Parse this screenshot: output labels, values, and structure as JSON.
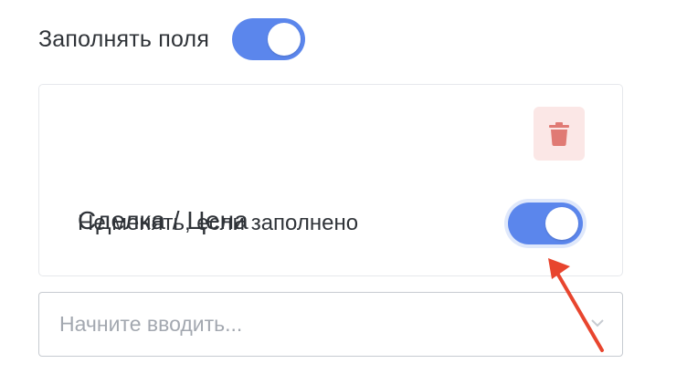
{
  "fill_fields": {
    "label": "Заполнять поля",
    "enabled": true
  },
  "field_card": {
    "title": "Сделка / Цена",
    "delete_icon": "trash-icon",
    "keep_if_filled": {
      "label": "Не менять, если заполнено",
      "enabled": true
    }
  },
  "search": {
    "placeholder": "Начните вводить...",
    "value": "",
    "chevron_icon": "chevron-down-icon"
  },
  "colors": {
    "toggle_on": "#5b86ec",
    "delete_bg": "#fbe7e6",
    "delete_icon": "#e07a74",
    "annotation_arrow": "#e8452e"
  }
}
